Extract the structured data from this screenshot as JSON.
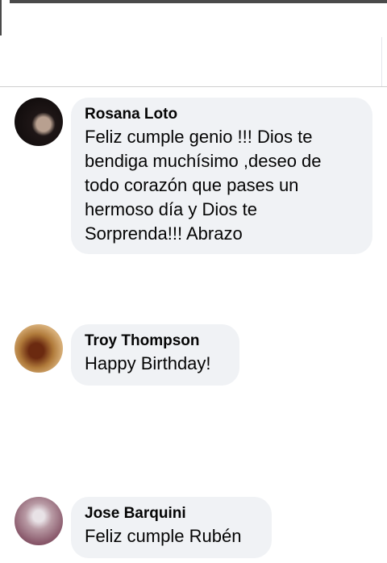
{
  "comments": [
    {
      "author": "Rosana Loto",
      "avatar_icon": "profile-photo",
      "lines": [
        "Feliz cumple genio !!! Dios te",
        "bendiga muchísimo ,deseo de",
        "todo corazón que pases un",
        "hermoso día y Dios te",
        "Sorprenda!!! Abrazo"
      ]
    },
    {
      "author": "Troy Thompson",
      "avatar_icon": "profile-photo",
      "lines": [
        "Happy Birthday!"
      ]
    },
    {
      "author": "Jose Barquini",
      "avatar_icon": "profile-photo",
      "lines": [
        "Feliz cumple Rubén"
      ]
    }
  ],
  "colors": {
    "bubble_background": "#f0f2f5",
    "text": "#050505",
    "divider": "#cfcfcf"
  }
}
